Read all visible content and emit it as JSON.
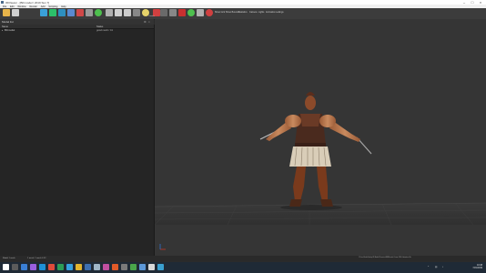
{
  "window": {
    "title": "3DViewer - [Bill.model / 2019 Sun 7]"
  },
  "menubar": {
    "items": [
      "File",
      "Edit",
      "Window",
      "Render",
      "Add",
      "Scripting",
      "Help"
    ]
  },
  "toolbar": {
    "text_buttons": [
      "Show Grid",
      "Show Bounds",
      "Statistics",
      "Camera",
      "Lights",
      "Animation settings"
    ],
    "right_label": "Center",
    "icon_colors": [
      "#e8b54a",
      "#c0c0c0",
      "#3aa0d8",
      "#2cc06a",
      "#2e8fbf",
      "#5a8ad0",
      "#d04848",
      "#9a9a9a",
      "#e0e0e0",
      "#b0b0b0",
      "#d0d0d0",
      "#cccccc",
      "#e6d36a",
      "#d04040",
      "#888888",
      "#4ec04e",
      "#b0b0b0",
      "#c83030",
      "#d2d2d2",
      "#d04040"
    ]
  },
  "filter": {
    "label": "Model list"
  },
  "panel": {
    "headers": {
      "name": "Name",
      "status": "Status"
    },
    "rows": [
      {
        "name": "Bill.model",
        "status": "good mesh / 41"
      }
    ]
  },
  "statusbar": {
    "left_text": "Model 1 mesh",
    "left_text2": "1 mesh: 1 mesh 4.32",
    "right_text": "C:\\Users\\Stefan\\Desktop\\3D Models\\Characters\\Bill\\Bill.model - Frame 13/60 - Animation: Idle"
  },
  "taskbar": {
    "time": "10:48",
    "date": "7/21/2019",
    "app_colors": [
      "#ffffff",
      "#5b5b5b",
      "#3a7fd5",
      "#9a5fe0",
      "#1e90d6",
      "#e04a3a",
      "#2c9c57",
      "#35a0e0",
      "#e2b42e",
      "#3d6fb0",
      "#9fb6c8",
      "#c04fa0",
      "#e05a28",
      "#7a7a7a",
      "#4aa64a",
      "#5c98d8",
      "#d8d8d8",
      "#3aa0d0"
    ]
  },
  "viewport": {
    "background": "#353535",
    "axis_x_color": "#c0392b",
    "axis_y_color": "#2e6fd0"
  }
}
